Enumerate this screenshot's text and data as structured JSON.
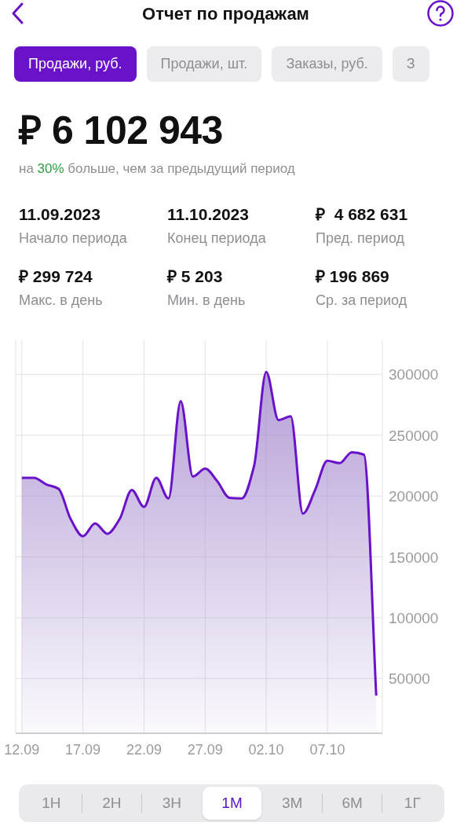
{
  "header": {
    "title": "Отчет по продажам"
  },
  "tabs": [
    {
      "label": "Продажи, руб.",
      "selected": true
    },
    {
      "label": "Продажи, шт.",
      "selected": false
    },
    {
      "label": "Заказы, руб.",
      "selected": false
    },
    {
      "label": "З",
      "selected": false
    }
  ],
  "total": {
    "value": "₽ 6 102 943",
    "comparison": "на **30%** больше, чем за предыдущий период"
  },
  "stats": [
    {
      "value": "11.09.2023",
      "label": "Начало периода"
    },
    {
      "value": "11.10.2023",
      "label": "Конец периода"
    },
    {
      "value": "₽  4 682 631",
      "label": "Пред. период"
    },
    {
      "value": "₽ 299 724",
      "label": "Макс. в день"
    },
    {
      "value": "₽ 5 203",
      "label": "Мин. в день"
    },
    {
      "value": "₽ 196 869",
      "label": "Ср. за период"
    }
  ],
  "chart": {
    "chart_data": {
      "type": "area",
      "categories": [
        "12.09",
        null,
        null,
        null,
        null,
        "17.09",
        null,
        null,
        null,
        null,
        "22.09",
        null,
        null,
        null,
        null,
        "27.09",
        null,
        null,
        null,
        null,
        "02.10",
        null,
        null,
        null,
        null,
        "07.10",
        null,
        null,
        null,
        null
      ],
      "series": [
        {
          "color": "#6a12c9",
          "values": [
            215000,
            215000,
            209600,
            206000,
            181000,
            167000,
            177500,
            169000,
            181000,
            205000,
            191000,
            215000,
            198000,
            278000,
            216000,
            222500,
            212000,
            198500,
            198000,
            224500,
            302000,
            262500,
            265500,
            185500,
            205000,
            229000,
            227000,
            236000,
            234000,
            36000
          ]
        }
      ],
      "ylim": [
        5000,
        328000
      ],
      "grid": true,
      "yticks": [
        {
          "value": 300000,
          "label": "300000"
        },
        {
          "value": 250000,
          "label": "250000"
        },
        {
          "value": 200000,
          "label": "200000"
        },
        {
          "value": 150000,
          "label": "150000"
        },
        {
          "value": 100000,
          "label": "100000"
        },
        {
          "value": 50000,
          "label": "50000"
        }
      ]
    }
  },
  "periods": [
    {
      "label": "1Н",
      "selected": false
    },
    {
      "label": "2Н",
      "selected": false
    },
    {
      "label": "3Н",
      "selected": false
    },
    {
      "label": "1М",
      "selected": true
    },
    {
      "label": "3М",
      "selected": false
    },
    {
      "label": "6М",
      "selected": false
    },
    {
      "label": "1Г",
      "selected": false
    }
  ]
}
